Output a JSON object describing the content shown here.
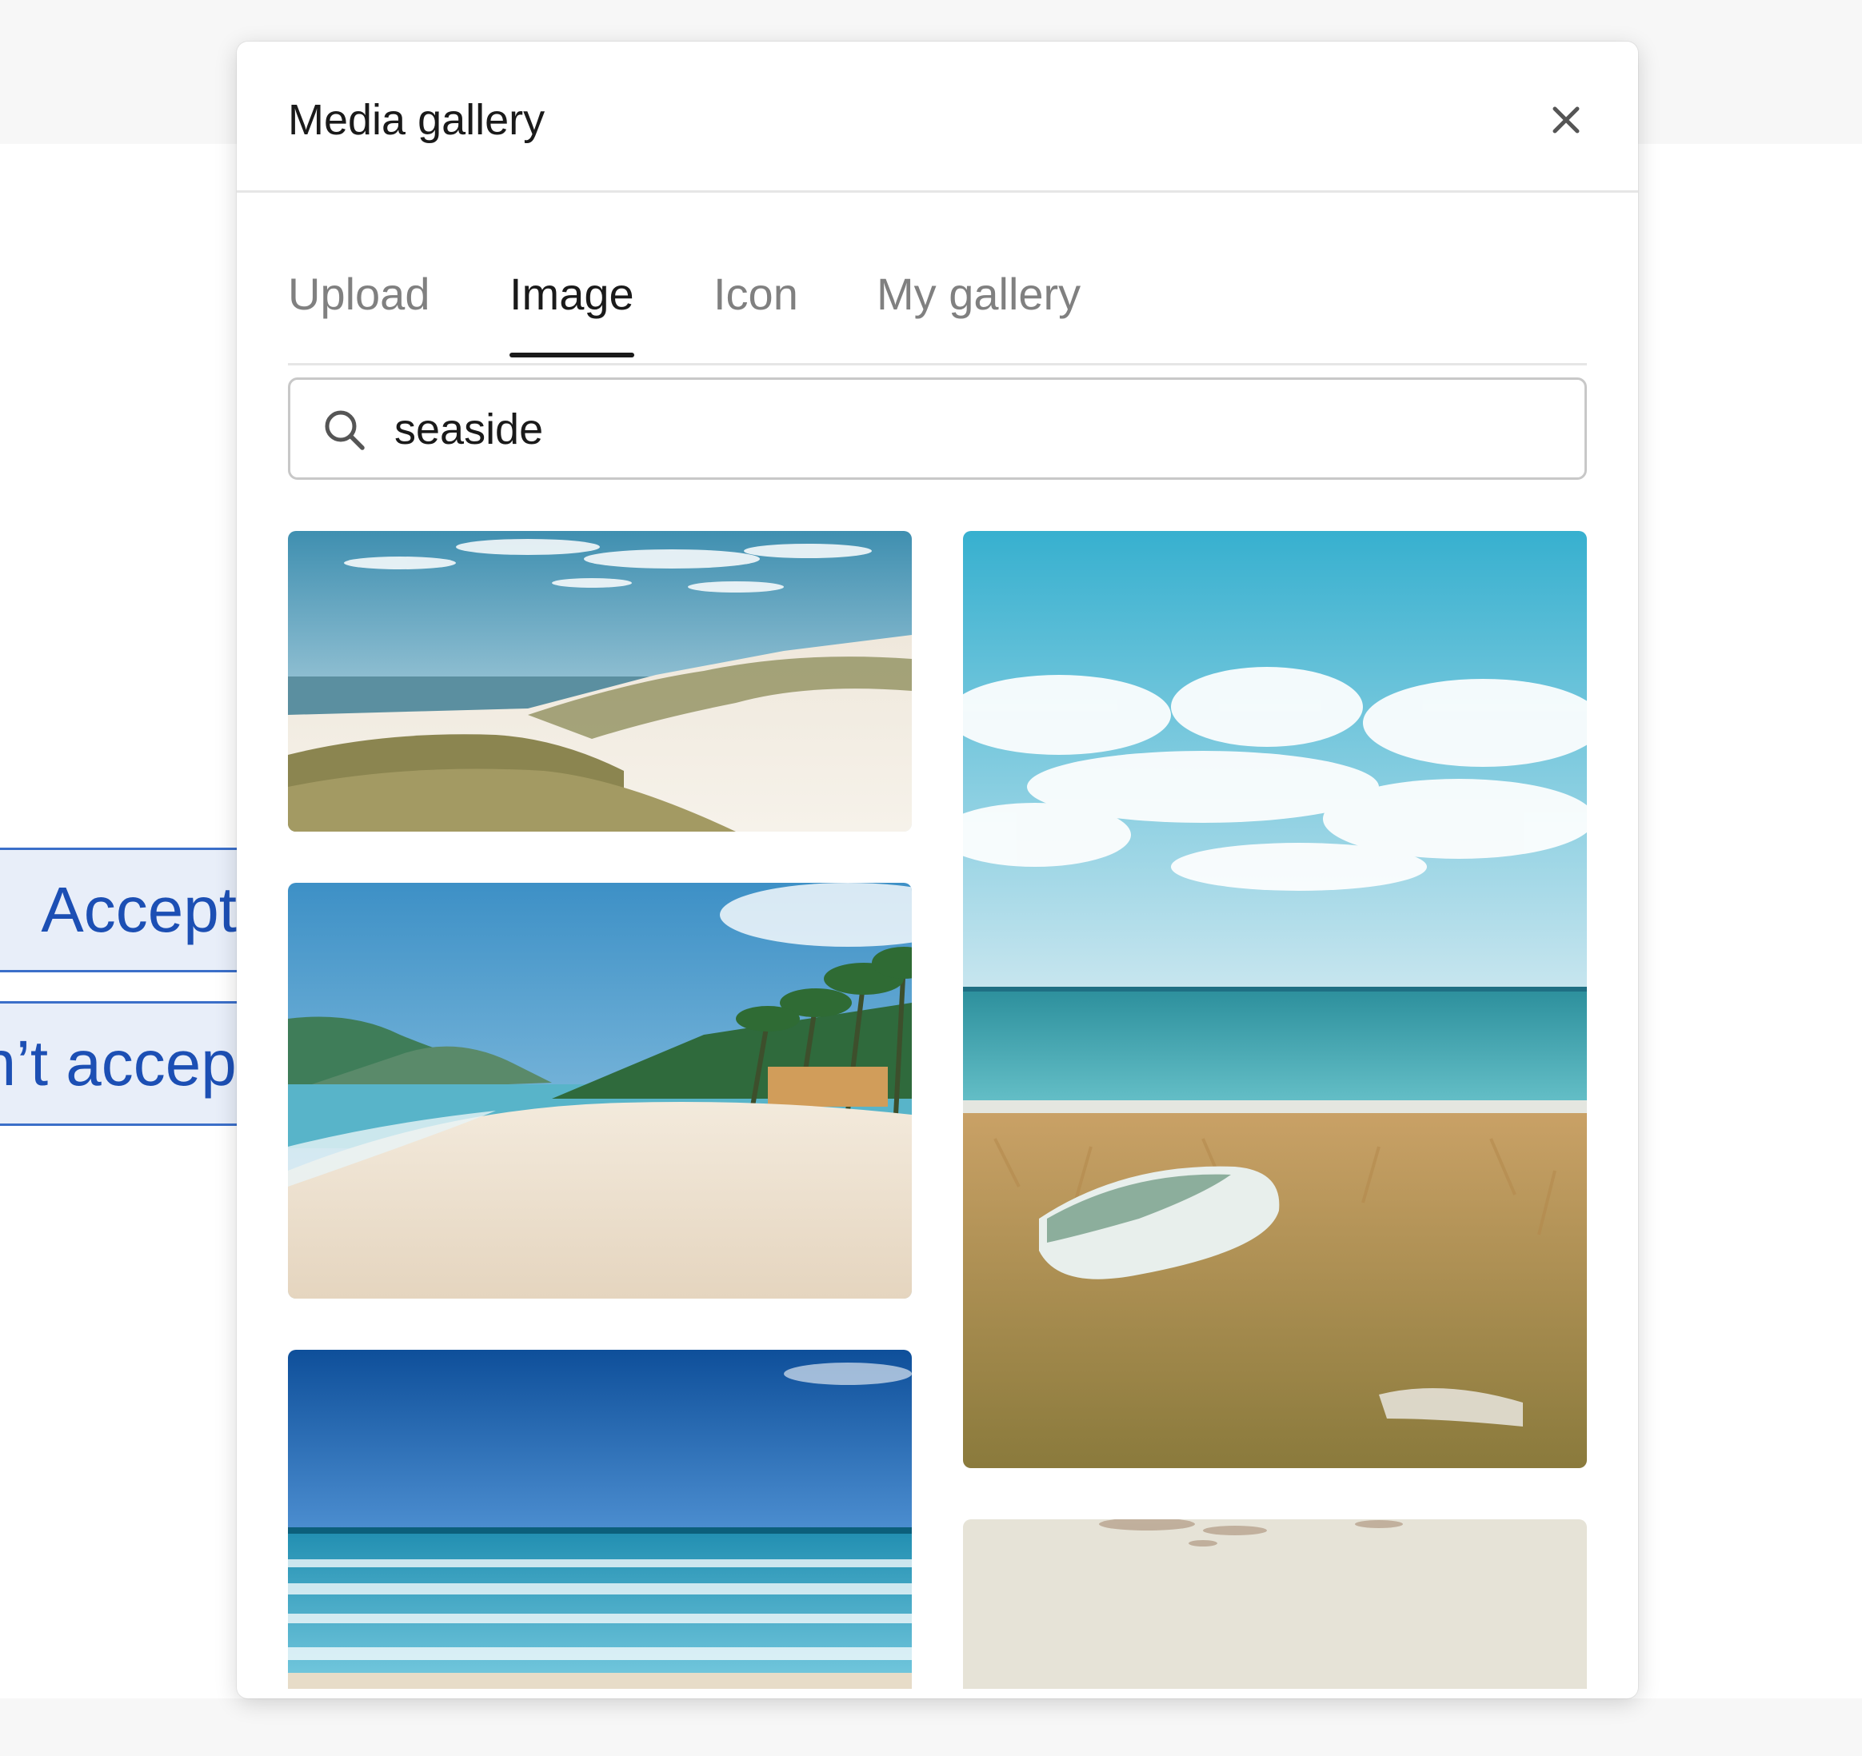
{
  "background": {
    "accept_label": "Accept",
    "decline_label": "Don’t accept"
  },
  "modal": {
    "title": "Media gallery",
    "close_icon": "close-icon"
  },
  "tabs": [
    {
      "label": "Upload",
      "active": false
    },
    {
      "label": "Image",
      "active": true
    },
    {
      "label": "Icon",
      "active": false
    },
    {
      "label": "My gallery",
      "active": false
    }
  ],
  "search": {
    "icon": "search-icon",
    "value": "seaside"
  },
  "colors": {
    "text_primary": "#1a1a1a",
    "text_muted": "#808080",
    "link_blue": "#1c4fb4",
    "button_bg": "#e8eef9"
  }
}
